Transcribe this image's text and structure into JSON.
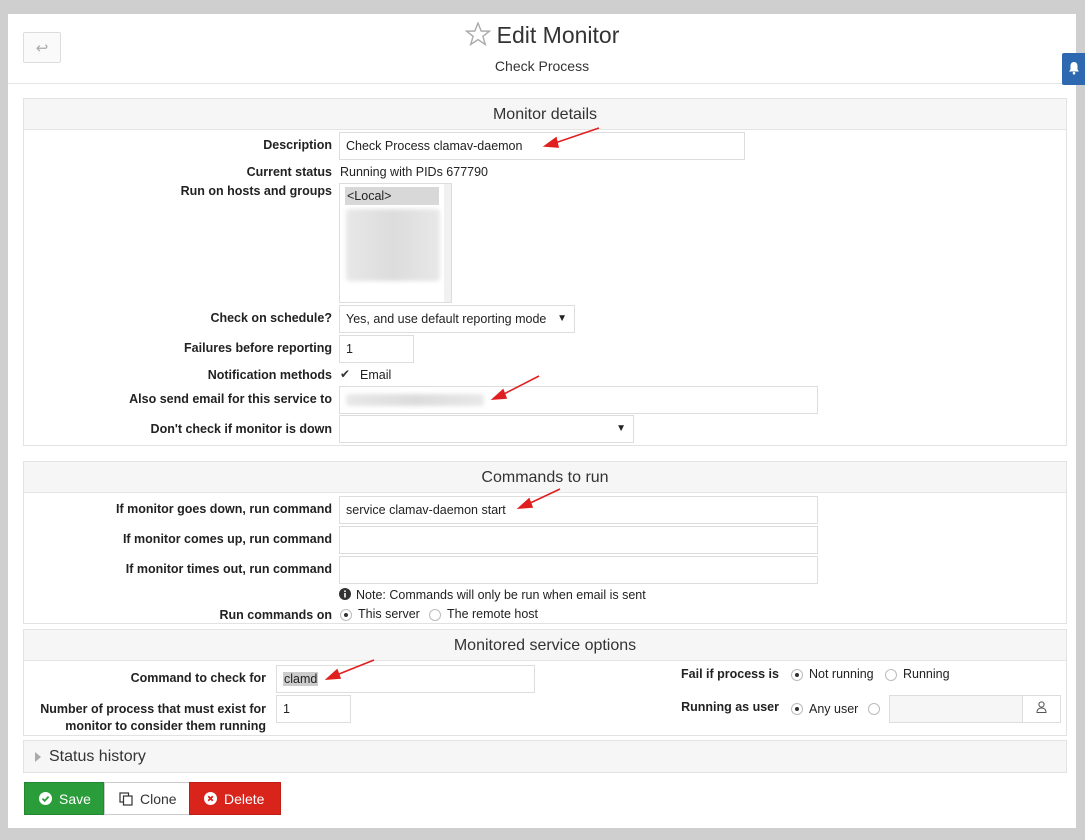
{
  "header": {
    "back_glyph": "↩",
    "title": "Edit Monitor",
    "subtitle": "Check Process"
  },
  "monitor_details": {
    "heading": "Monitor details",
    "description_label": "Description",
    "description_value": "Check Process clamav-daemon",
    "status_label": "Current status",
    "status_value": "Running with PIDs 677790",
    "hosts_label": "Run on hosts and groups",
    "hosts_options": [
      "<Local>"
    ],
    "schedule_label": "Check on schedule?",
    "schedule_value": "Yes, and use default reporting mode",
    "failures_label": "Failures before reporting",
    "failures_value": "1",
    "notify_label": "Notification methods",
    "notify_option": "Email",
    "email_label": "Also send email for this service to",
    "dont_check_label": "Don't check if monitor is down",
    "dont_check_value": ""
  },
  "commands": {
    "heading": "Commands to run",
    "down_label": "If monitor goes down, run command",
    "down_value": "service clamav-daemon start",
    "up_label": "If monitor comes up, run command",
    "up_value": "",
    "timeout_label": "If monitor times out, run command",
    "timeout_value": "",
    "note": "Note: Commands will only be run when email is sent",
    "run_on_label": "Run commands on",
    "run_on_options": [
      "This server",
      "The remote host"
    ],
    "run_on_selected": "This server"
  },
  "service_options": {
    "heading": "Monitored service options",
    "command_label": "Command to check for",
    "command_value": "clamd",
    "count_label_line1": "Number of process that must exist for",
    "count_label_line2": "monitor to consider them running",
    "count_value": "1",
    "fail_label": "Fail if process is",
    "fail_options": [
      "Not running",
      "Running"
    ],
    "fail_selected": "Not running",
    "user_label": "Running as user",
    "user_options": [
      "Any user"
    ],
    "user_selected": "Any user"
  },
  "status_history": {
    "label": "Status history"
  },
  "actions": {
    "save": "Save",
    "clone": "Clone",
    "delete": "Delete"
  },
  "colors": {
    "save": "#2a9d3a",
    "delete": "#d9241c",
    "side_tab": "#2d68b0",
    "annotation_arrow": "#e02020"
  }
}
